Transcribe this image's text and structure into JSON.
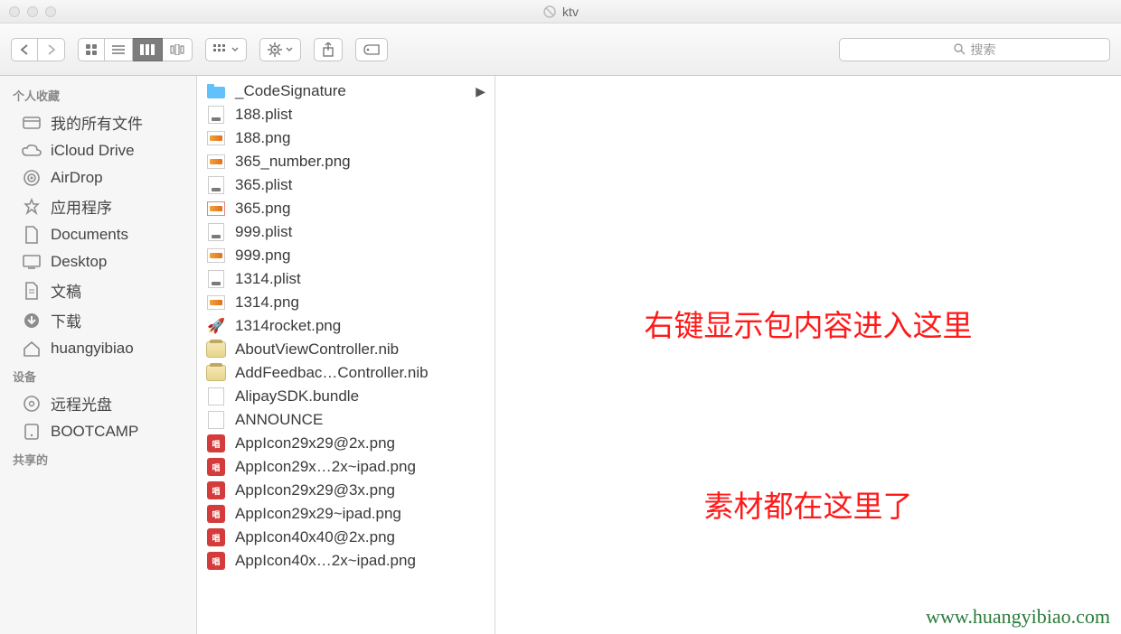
{
  "title": "ktv",
  "search_placeholder": "搜索",
  "annotations": {
    "line1": "右键显示包内容进入这里",
    "line2": "素材都在这里了"
  },
  "watermark": "www.huangyibiao.com",
  "sidebar": {
    "sections": [
      {
        "title": "个人收藏",
        "items": [
          {
            "label": "我的所有文件",
            "icon": "all-files-icon"
          },
          {
            "label": "iCloud Drive",
            "icon": "icloud-icon"
          },
          {
            "label": "AirDrop",
            "icon": "airdrop-icon"
          },
          {
            "label": "应用程序",
            "icon": "applications-icon"
          },
          {
            "label": "Documents",
            "icon": "documents-icon"
          },
          {
            "label": "Desktop",
            "icon": "desktop-icon"
          },
          {
            "label": "文稿",
            "icon": "docs-icon"
          },
          {
            "label": "下载",
            "icon": "downloads-icon"
          },
          {
            "label": "huangyibiao",
            "icon": "home-icon"
          }
        ]
      },
      {
        "title": "设备",
        "items": [
          {
            "label": "远程光盘",
            "icon": "disc-icon"
          },
          {
            "label": "BOOTCAMP",
            "icon": "hdd-icon"
          }
        ]
      },
      {
        "title": "共享的",
        "items": []
      }
    ]
  },
  "files": [
    {
      "name": "_CodeSignature",
      "type": "folder",
      "expandable": true
    },
    {
      "name": "188.plist",
      "type": "plist"
    },
    {
      "name": "188.png",
      "type": "png"
    },
    {
      "name": "365_number.png",
      "type": "png"
    },
    {
      "name": "365.plist",
      "type": "plist"
    },
    {
      "name": "365.png",
      "type": "png-alt"
    },
    {
      "name": "999.plist",
      "type": "plist"
    },
    {
      "name": "999.png",
      "type": "png"
    },
    {
      "name": "1314.plist",
      "type": "plist"
    },
    {
      "name": "1314.png",
      "type": "png"
    },
    {
      "name": "1314rocket.png",
      "type": "rocket"
    },
    {
      "name": "AboutViewController.nib",
      "type": "nib"
    },
    {
      "name": "AddFeedbac…Controller.nib",
      "type": "nib"
    },
    {
      "name": "AlipaySDK.bundle",
      "type": "doc"
    },
    {
      "name": "ANNOUNCE",
      "type": "doc"
    },
    {
      "name": "AppIcon29x29@2x.png",
      "type": "png-red"
    },
    {
      "name": "AppIcon29x…2x~ipad.png",
      "type": "png-red"
    },
    {
      "name": "AppIcon29x29@3x.png",
      "type": "png-red"
    },
    {
      "name": "AppIcon29x29~ipad.png",
      "type": "png-red"
    },
    {
      "name": "AppIcon40x40@2x.png",
      "type": "png-red"
    },
    {
      "name": "AppIcon40x…2x~ipad.png",
      "type": "png-red"
    }
  ]
}
